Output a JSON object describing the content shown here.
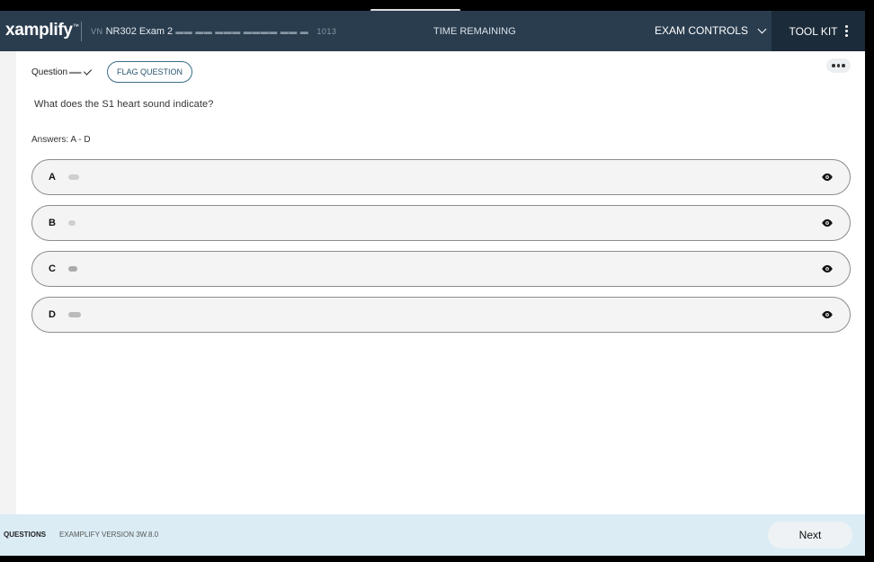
{
  "header": {
    "logo_text": "xamplify",
    "exam_title": "NR302 Exam 2",
    "exam_title_prefix": "VN",
    "exam_title_suffix": "1013",
    "time_label": "TIME REMAINING",
    "exam_controls_label": "EXAM CONTROLS",
    "toolkit_label": "TOOL KIT"
  },
  "question": {
    "label": "Question",
    "flag_label": "FLAG QUESTION",
    "text": "What does the S1 heart sound indicate?",
    "answers_label": "Answers: A - D"
  },
  "answers": [
    {
      "letter": "A",
      "text": ""
    },
    {
      "letter": "B",
      "text": ""
    },
    {
      "letter": "C",
      "text": ""
    },
    {
      "letter": "D",
      "text": ""
    }
  ],
  "footer": {
    "questions_label": "QUESTIONS",
    "version": "EXAMPLIFY VERSION 3W.8.0",
    "next_label": "Next"
  },
  "colors": {
    "header_bg": "#2a3d4f",
    "toolkit_bg": "#1c2b39",
    "footer_bg": "#dbecf5",
    "accent": "#3a6d8a"
  },
  "icons": {
    "exam_controls": "chevron-down-icon",
    "toolkit": "kebab-menu-icon",
    "more": "more-horizontal-icon",
    "answer_visibility": "eye-icon",
    "question_status": "checkmark-icon"
  }
}
